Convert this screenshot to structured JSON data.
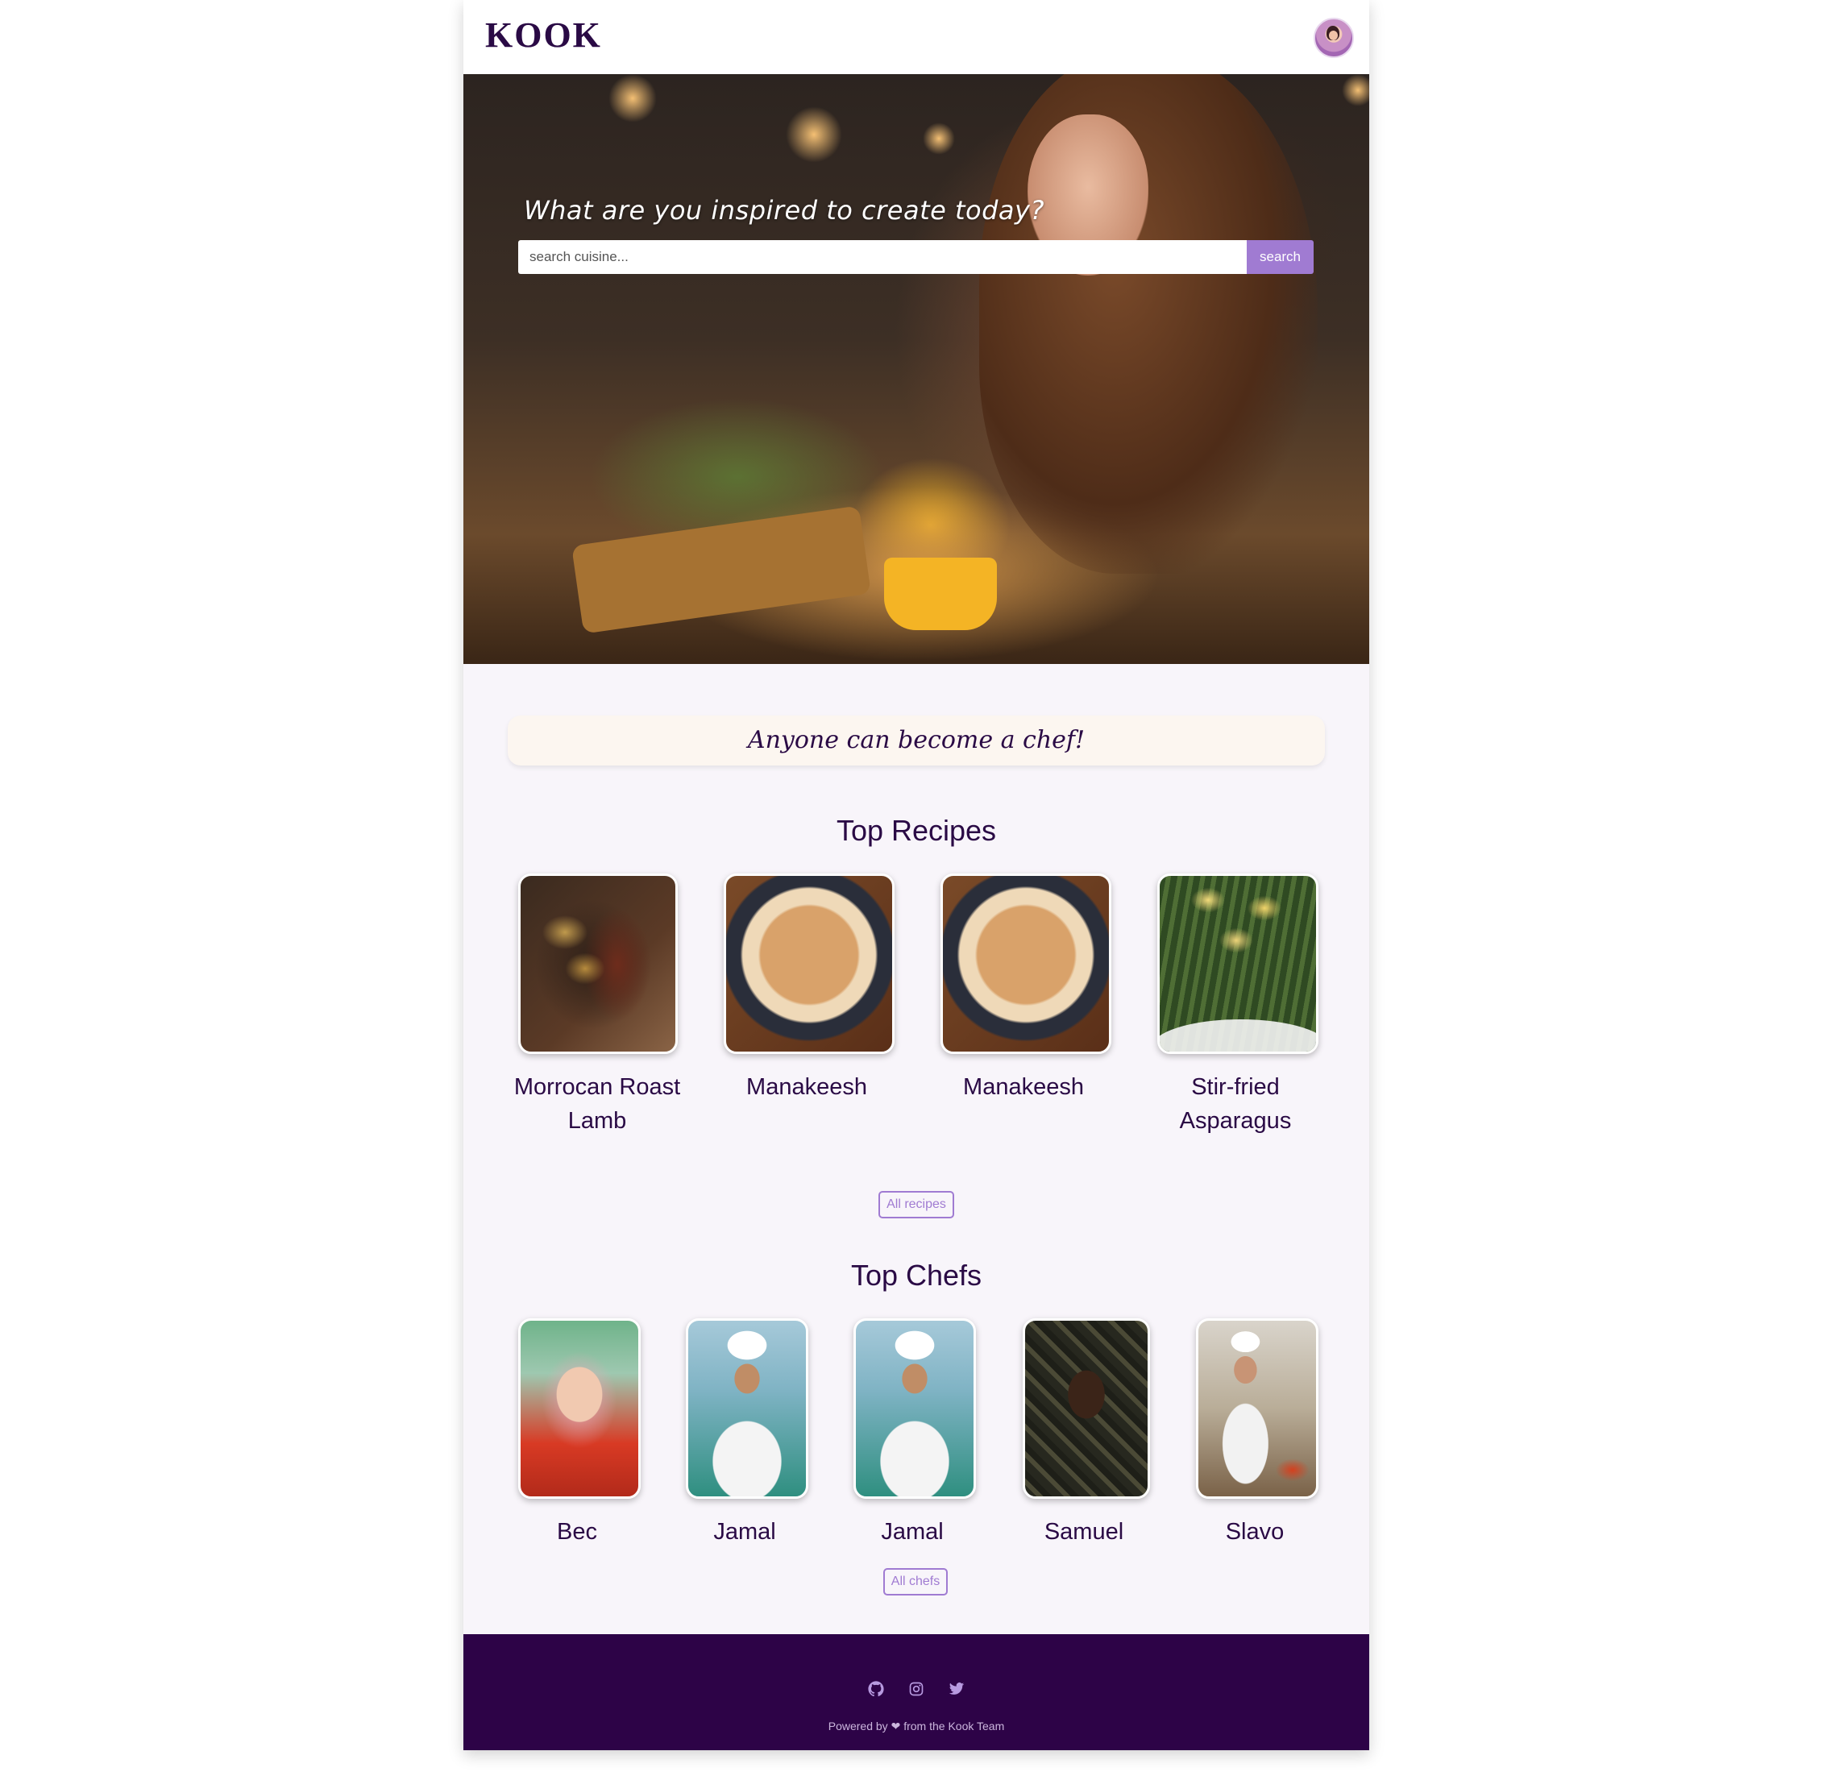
{
  "header": {
    "logo": "KOOK"
  },
  "hero": {
    "title": "What are you inspired to create today?",
    "search": {
      "placeholder": "search cuisine...",
      "value": "",
      "button_label": "search"
    }
  },
  "tagline": "Anyone can become a chef!",
  "recipes": {
    "title": "Top Recipes",
    "items": [
      {
        "name": "Morrocan Roast Lamb",
        "image": "roast-lamb-photo"
      },
      {
        "name": "Manakeesh",
        "image": "manakeesh-photo"
      },
      {
        "name": "Manakeesh",
        "image": "manakeesh-photo"
      },
      {
        "name": "Stir-fried Asparagus",
        "image": "asparagus-photo"
      }
    ],
    "all_label": "All recipes"
  },
  "chefs": {
    "title": "Top Chefs",
    "items": [
      {
        "name": "Bec",
        "image": "chef-bec-photo"
      },
      {
        "name": "Jamal",
        "image": "chef-jamal-photo"
      },
      {
        "name": "Jamal",
        "image": "chef-jamal-photo"
      },
      {
        "name": "Samuel",
        "image": "chef-samuel-photo"
      },
      {
        "name": "Slavo",
        "image": "chef-slavo-photo"
      }
    ],
    "all_label": "All chefs"
  },
  "footer": {
    "icons": [
      "github-icon",
      "instagram-icon",
      "twitter-icon"
    ],
    "powered_prefix": "Powered by",
    "powered_suffix": "from the Kook Team"
  },
  "colors": {
    "brand": "#2a0a45",
    "accent": "#a07bd2",
    "footer_bg": "#2d0347"
  }
}
